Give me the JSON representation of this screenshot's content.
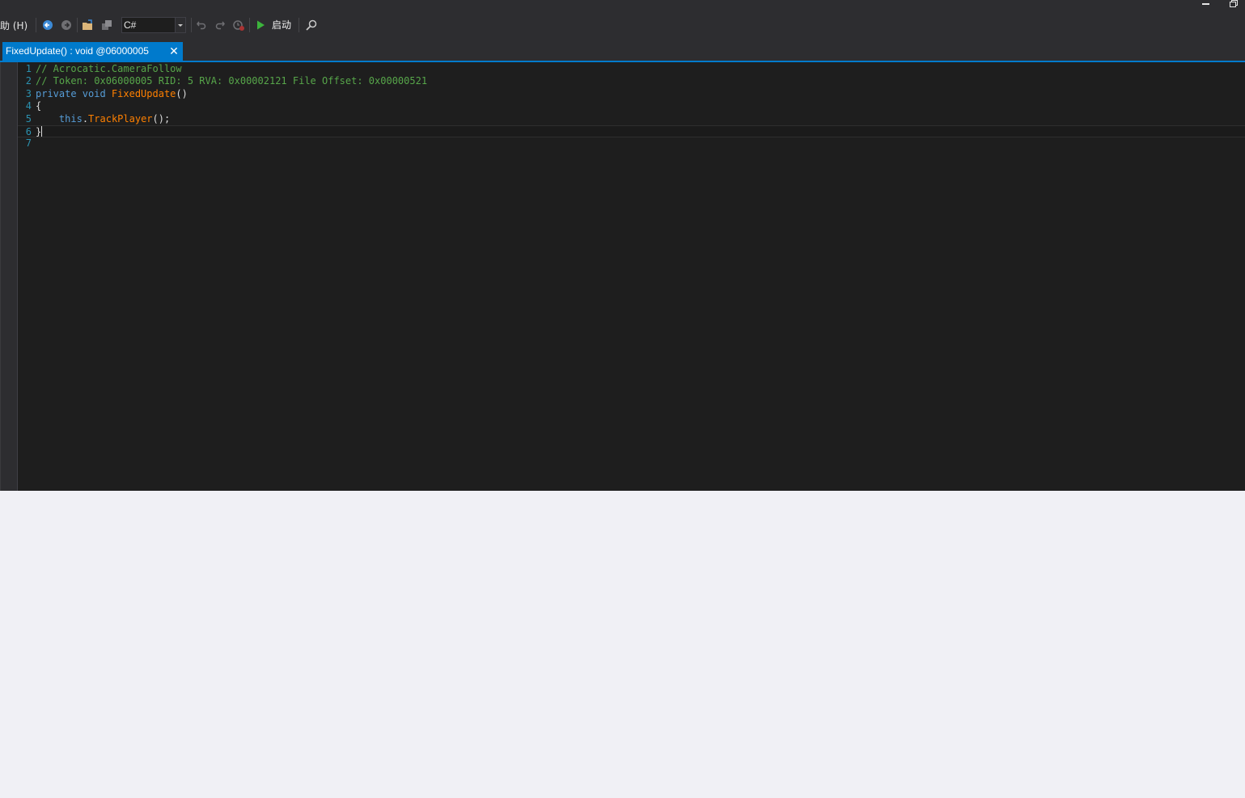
{
  "window": {
    "minimize_label": "minimize",
    "restore_label": "restore"
  },
  "toolbar": {
    "menu_help": "助 (H)",
    "language": "C#",
    "run_label": "启动",
    "icons": [
      "back-icon",
      "forward-icon",
      "open-file-icon",
      "open-list-icon",
      "undo-icon",
      "redo-icon",
      "history-icon",
      "play-icon",
      "search-icon"
    ]
  },
  "tab": {
    "title": "FixedUpdate() : void @06000005",
    "close_glyph": "✕"
  },
  "editor": {
    "line_numbers": [
      "1",
      "2",
      "3",
      "4",
      "5",
      "6",
      "7"
    ],
    "lines": [
      {
        "n": "1",
        "parts": [
          {
            "t": "// Acrocatic.CameraFollow",
            "k": "comment"
          }
        ]
      },
      {
        "n": "2",
        "parts": [
          {
            "t": "// Token: 0x06000005 RID: 5 RVA: 0x00002121 File Offset: 0x00000521",
            "k": "comment"
          }
        ]
      },
      {
        "n": "3",
        "parts": [
          {
            "t": "private void ",
            "k": "kw"
          },
          {
            "t": "FixedUpdate",
            "k": "method"
          },
          {
            "t": "()",
            "k": "plain"
          }
        ]
      },
      {
        "n": "4",
        "parts": [
          {
            "t": "{",
            "k": "plain"
          }
        ]
      },
      {
        "n": "5",
        "parts": [
          {
            "t": "    ",
            "k": "plain"
          },
          {
            "t": "this",
            "k": "kw"
          },
          {
            "t": ".",
            "k": "plain"
          },
          {
            "t": "TrackPlayer",
            "k": "method"
          },
          {
            "t": "();",
            "k": "plain"
          }
        ]
      },
      {
        "n": "6",
        "parts": [
          {
            "t": "}",
            "k": "plain"
          }
        ]
      },
      {
        "n": "7",
        "parts": []
      }
    ],
    "current_line": 6,
    "colors": {
      "background": "#1e1e1e",
      "comment": "#57a64a",
      "keyword": "#569cd6",
      "method": "#ff8000",
      "plain": "#dcdcdc",
      "line_number": "#2b91af",
      "accent": "#007acc"
    }
  }
}
